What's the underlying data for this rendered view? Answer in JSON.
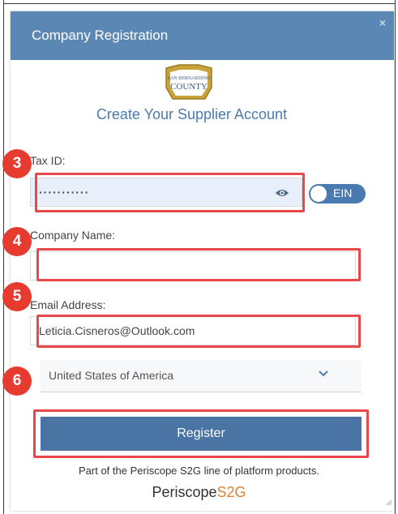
{
  "dialog": {
    "title": "Company Registration",
    "close_icon": "×"
  },
  "logo": {
    "line1": "SAN BERNARDINO",
    "line2": "COUNTY"
  },
  "heading": "Create Your Supplier Account",
  "steps": [
    "3",
    "4",
    "5",
    "6"
  ],
  "tax_id": {
    "label": "Tax ID:",
    "value": "···········",
    "show_password_icon": "eye-icon",
    "toggle_label": "EIN"
  },
  "company_name": {
    "label": "Company Name:",
    "value": ""
  },
  "email": {
    "label": "Email Address:",
    "value": "Leticia.Cisneros@Outlook.com"
  },
  "country": {
    "selected": "United States of America",
    "icon": "chevron-down-icon"
  },
  "register_button": "Register",
  "footer": {
    "text": "Part of the Periscope S2G line of platform products.",
    "brand_part1": "Periscope",
    "brand_part2": "S2G"
  },
  "colors": {
    "header": "#5b87b5",
    "accent": "#4a7bb0",
    "highlight": "#e8474c",
    "step_badge": "#e63b2e",
    "brand_orange": "#e2812f"
  }
}
